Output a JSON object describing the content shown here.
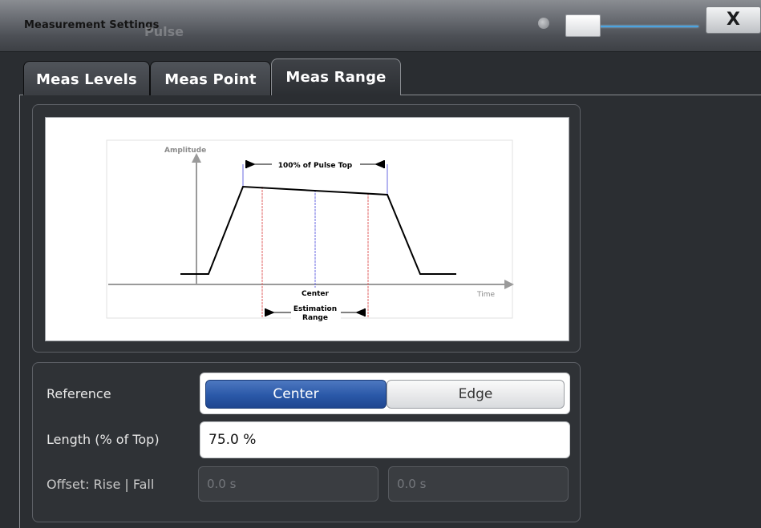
{
  "window": {
    "title": "Measurement Settings",
    "ghost_text": "Pulse",
    "close_label": "X"
  },
  "tabs": [
    {
      "label": "Meas Levels",
      "active": false
    },
    {
      "label": "Meas Point",
      "active": false
    },
    {
      "label": "Meas Range",
      "active": true
    }
  ],
  "diagram": {
    "amplitude_label": "Amplitude",
    "time_label": "Time",
    "pulse_top_label": "100% of Pulse Top",
    "center_label": "Center",
    "estimation_label": "Estimation",
    "range_label": "Range"
  },
  "settings": {
    "reference_label": "Reference",
    "reference_options": [
      "Center",
      "Edge"
    ],
    "reference_selected": "Center",
    "length_label": "Length (% of Top)",
    "length_value": "75.0 %",
    "offset_label": "Offset: Rise | Fall",
    "offset_rise": "0.0 s",
    "offset_fall": "0.0 s"
  },
  "colors": {
    "selected_blue": "#2a58a8",
    "slider_blue": "#4aa3e0",
    "marker_blue": "#6a6ae0",
    "marker_red": "#e06060"
  },
  "icons": {
    "dot": "dot-icon",
    "transparency_slider": "transparency-slider",
    "close": "close-icon"
  }
}
